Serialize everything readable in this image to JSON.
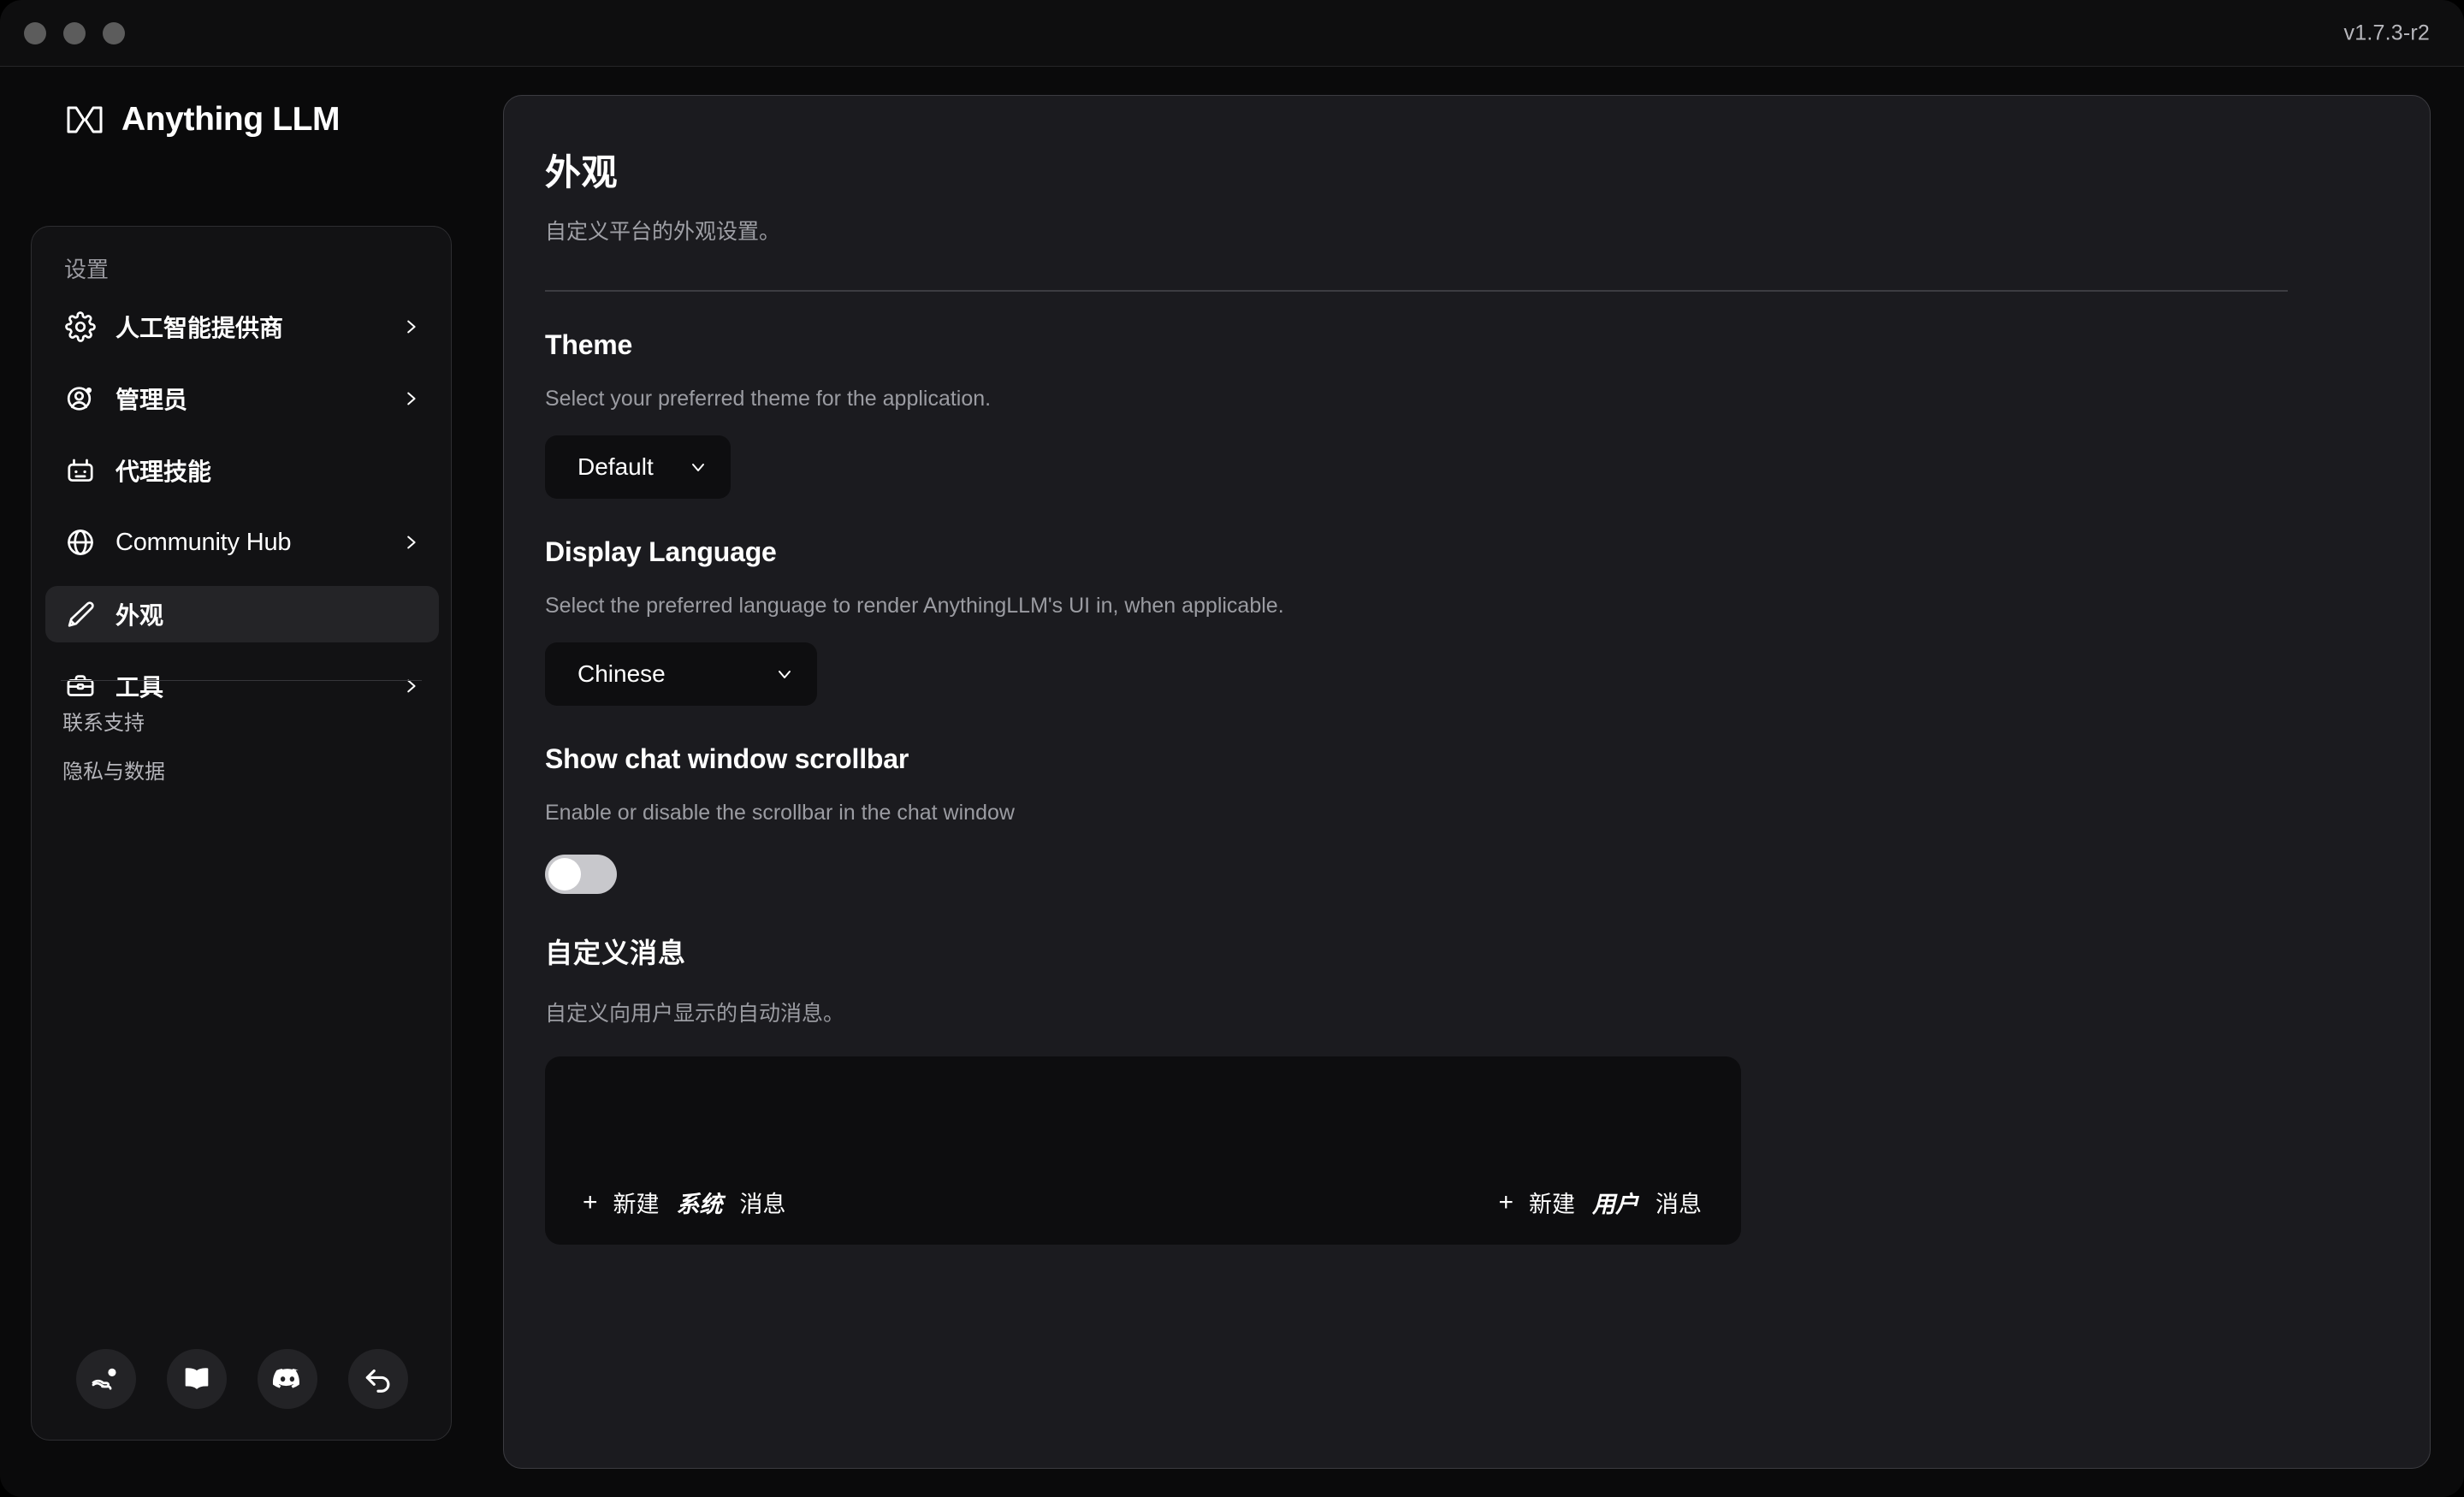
{
  "window": {
    "version": "v1.7.3-r2",
    "traffic_lights": [
      "close",
      "minimize",
      "maximize"
    ]
  },
  "sidebar": {
    "brand": "Anything LLM",
    "brand_logo_icon": "anythingllm-logo-icon",
    "section_label": "设置",
    "items": [
      {
        "label": "人工智能提供商",
        "icon": "gear-icon",
        "chevron": true,
        "active": false,
        "latin": false
      },
      {
        "label": "管理员",
        "icon": "user-gear-icon",
        "chevron": true,
        "active": false,
        "latin": false
      },
      {
        "label": "代理技能",
        "icon": "robot-icon",
        "chevron": false,
        "active": false,
        "latin": false
      },
      {
        "label": "Community Hub",
        "icon": "globe-icon",
        "chevron": true,
        "active": false,
        "latin": true
      },
      {
        "label": "外观",
        "icon": "pencil-icon",
        "chevron": false,
        "active": true,
        "latin": false
      },
      {
        "label": "工具",
        "icon": "toolbox-icon",
        "chevron": true,
        "active": false,
        "latin": false
      }
    ],
    "footer_links": [
      {
        "label": "联系支持"
      },
      {
        "label": "隐私与数据"
      }
    ],
    "social_buttons": [
      {
        "icon": "hand-coin-icon",
        "name": "donate"
      },
      {
        "icon": "book-open-icon",
        "name": "docs"
      },
      {
        "icon": "discord-icon",
        "name": "discord"
      },
      {
        "icon": "arrow-back-icon",
        "name": "back"
      }
    ]
  },
  "main": {
    "title": "外观",
    "subtitle": "自定义平台的外观设置。",
    "theme": {
      "title": "Theme",
      "description": "Select your preferred theme for the application.",
      "selected": "Default",
      "options": [
        "Default"
      ]
    },
    "display_language": {
      "title": "Display Language",
      "description": "Select the preferred language to render AnythingLLM's UI in, when applicable.",
      "selected": "Chinese",
      "options": [
        "Chinese"
      ]
    },
    "scrollbar": {
      "title": "Show chat window scrollbar",
      "description": "Enable or disable the scrollbar in the chat window",
      "enabled": false
    },
    "custom_messages": {
      "title": "自定义消息",
      "description": "自定义向用户显示的自动消息。",
      "new_system_message": {
        "prefix": "新建",
        "emphasis": "系统",
        "suffix": "消息",
        "plus": "+"
      },
      "new_user_message": {
        "prefix": "新建",
        "emphasis": "用户",
        "suffix": "消息",
        "plus": "+"
      }
    }
  },
  "colors": {
    "page_bg": "#0a0a0b",
    "panel_bg": "#1b1b1f",
    "sidebar_panel_bg": "#121214",
    "border": "#3c3c41",
    "accent_text": "#ffffff",
    "muted_text": "#9b9ca2",
    "active_item_bg": "#242427",
    "toggle_off": "#c8c8cc"
  }
}
